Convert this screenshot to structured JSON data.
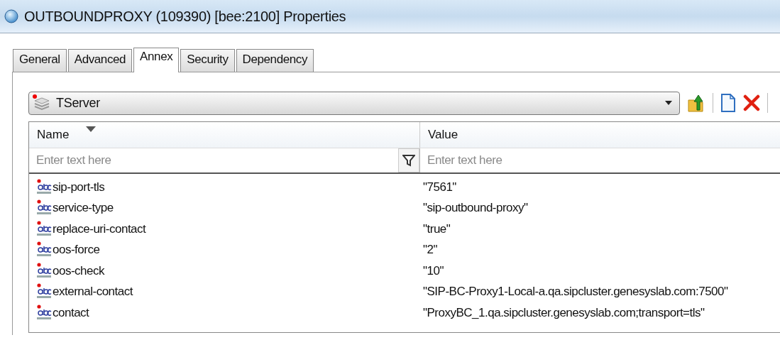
{
  "window": {
    "title": "OUTBOUNDPROXY (109390) [bee:2100] Properties"
  },
  "tabs": [
    {
      "label": "General",
      "selected": false
    },
    {
      "label": "Advanced",
      "selected": false
    },
    {
      "label": "Annex",
      "selected": true
    },
    {
      "label": "Security",
      "selected": false
    },
    {
      "label": "Dependency",
      "selected": false
    }
  ],
  "section_dropdown": {
    "value": "TServer"
  },
  "table": {
    "columns": [
      {
        "label": "Name",
        "sorted": true,
        "filter_placeholder": "Enter text here"
      },
      {
        "label": "Value",
        "sorted": false,
        "filter_placeholder": "Enter text here"
      }
    ],
    "rows": [
      {
        "name": "sip-port-tls",
        "value": "\"7561\""
      },
      {
        "name": "service-type",
        "value": "\"sip-outbound-proxy\""
      },
      {
        "name": "replace-uri-contact",
        "value": "\"true\""
      },
      {
        "name": "oos-force",
        "value": "\"2\""
      },
      {
        "name": "oos-check",
        "value": "\"10\""
      },
      {
        "name": "external-contact",
        "value": "\"SIP-BC-Proxy1-Local-a.qa.sipcluster.genesyslab.com:7500\""
      },
      {
        "name": "contact",
        "value": "\"ProxyBC_1.qa.sipcluster.genesyslab.com;transport=tls\""
      }
    ]
  }
}
